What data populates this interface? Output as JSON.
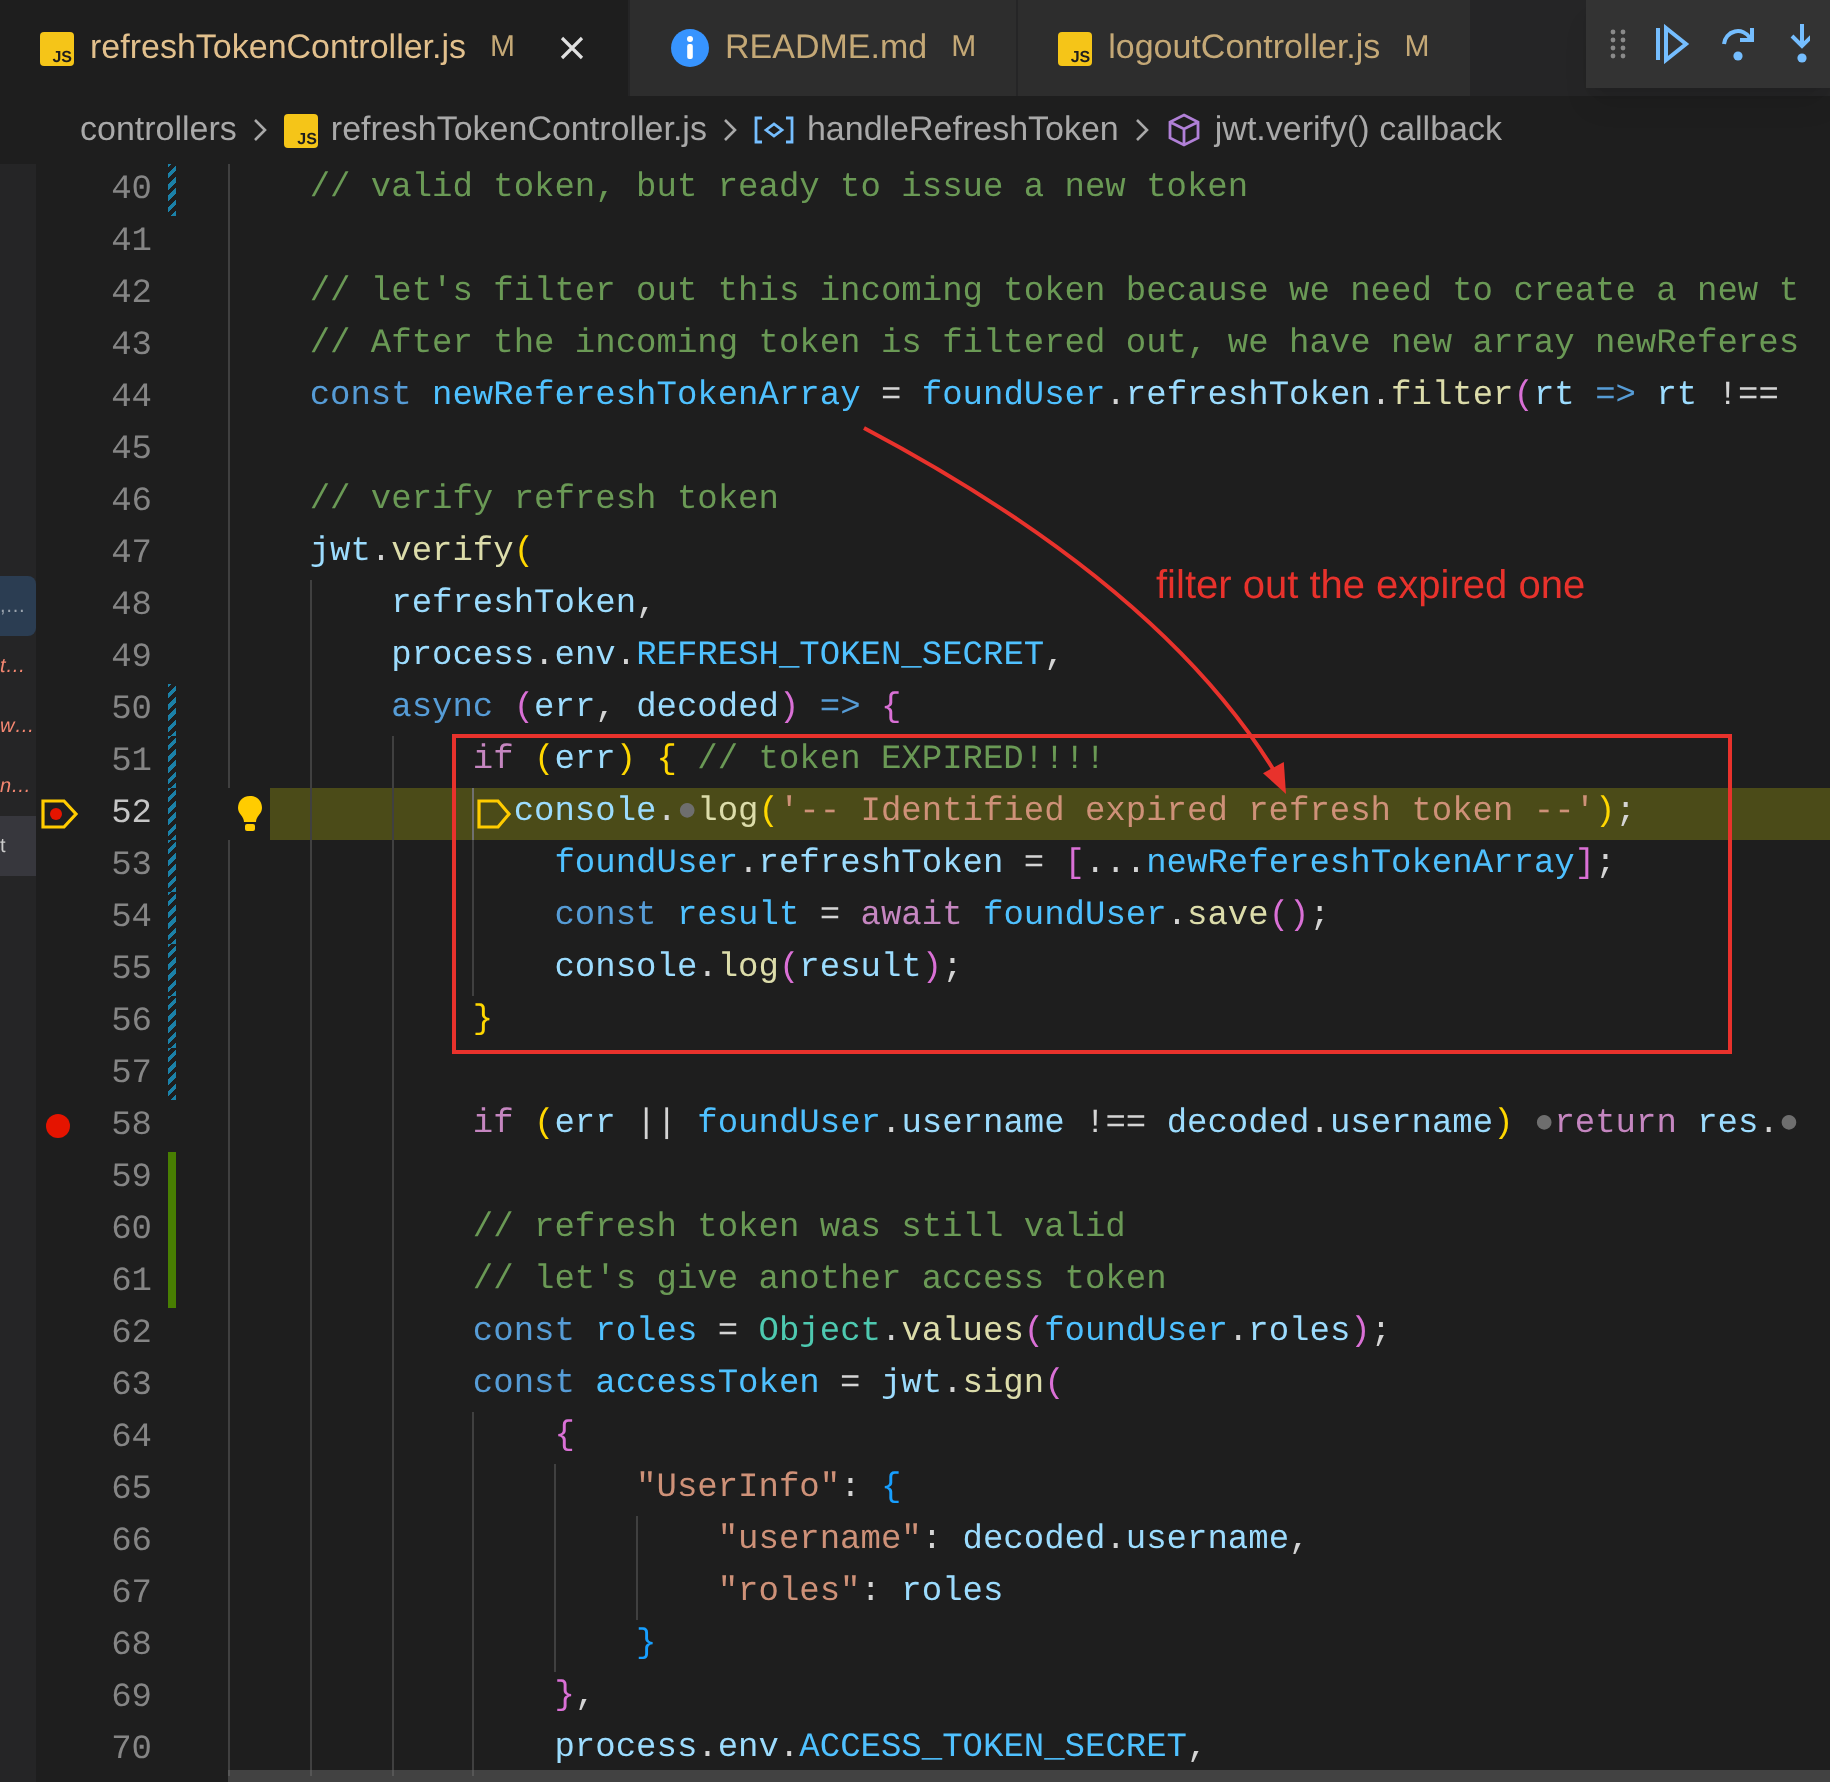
{
  "tabs": [
    {
      "file_icon": "JS",
      "label": "refreshTokenController.js",
      "status": "M",
      "selected": true
    },
    {
      "label": "README.md",
      "status": "M",
      "selected": false
    },
    {
      "file_icon": "JS",
      "label": "logoutController.js",
      "status": "M",
      "selected": false
    }
  ],
  "breadcrumb": [
    {
      "kind": "folder",
      "text": "controllers"
    },
    {
      "kind": "file",
      "file_icon": "JS",
      "text": "refreshTokenController.js"
    },
    {
      "kind": "variable",
      "text": "handleRefreshToken"
    },
    {
      "kind": "method",
      "text": "jwt.verify() callback"
    }
  ],
  "sidebar": {
    "items": [
      {
        "text": ",…",
        "selected": true,
        "error": false,
        "hovered": false
      },
      {
        "text": "t…",
        "selected": false,
        "error": true,
        "hovered": false
      },
      {
        "text": "w…",
        "selected": false,
        "error": true,
        "hovered": false
      },
      {
        "text": "n…",
        "selected": false,
        "error": true,
        "hovered": false
      },
      {
        "text": "t",
        "selected": false,
        "error": false,
        "hovered": true
      }
    ]
  },
  "editor": {
    "lines": [
      {
        "number": "40",
        "modified": true,
        "tokens": [
          {
            "text": "    // valid token, but ready to issue a new token",
            "kind": "comment"
          }
        ]
      },
      {
        "number": "41"
      },
      {
        "number": "42",
        "tokens": [
          {
            "text": "    // let's filter out this incoming token because we need to create a new t",
            "kind": "comment"
          }
        ]
      },
      {
        "number": "43",
        "tokens": [
          {
            "text": "    // After the incoming token is filtered out, we have new array newReferes",
            "kind": "comment"
          }
        ]
      },
      {
        "number": "44",
        "tokens": [
          {
            "text": "    const ",
            "kind": "keyword"
          },
          {
            "text": "newRefereshTokenArray",
            "kind": "constant"
          },
          {
            "text": " = ",
            "kind": "plain"
          },
          {
            "text": "foundUser",
            "kind": "constant"
          },
          {
            "text": ".",
            "kind": "plain"
          },
          {
            "text": "refreshToken",
            "kind": "variable"
          },
          {
            "text": ".",
            "kind": "plain"
          },
          {
            "text": "filter",
            "kind": "function"
          },
          {
            "text": "(",
            "kind": "bracket-pink"
          },
          {
            "text": "rt",
            "kind": "variable"
          },
          {
            "text": " => ",
            "kind": "keyword"
          },
          {
            "text": "rt",
            "kind": "variable"
          },
          {
            "text": " !==",
            "kind": "plain"
          }
        ]
      },
      {
        "number": "45"
      },
      {
        "number": "46",
        "tokens": [
          {
            "text": "    // verify refresh token",
            "kind": "comment"
          }
        ]
      },
      {
        "number": "47",
        "tokens": [
          {
            "text": "    jwt",
            "kind": "variable"
          },
          {
            "text": ".",
            "kind": "plain"
          },
          {
            "text": "verify",
            "kind": "function"
          },
          {
            "text": "(",
            "kind": "bracket-yellow"
          }
        ]
      },
      {
        "number": "48",
        "tokens": [
          {
            "text": "        refreshToken",
            "kind": "variable"
          },
          {
            "text": ",",
            "kind": "plain"
          }
        ]
      },
      {
        "number": "49",
        "tokens": [
          {
            "text": "        process",
            "kind": "variable"
          },
          {
            "text": ".",
            "kind": "plain"
          },
          {
            "text": "env",
            "kind": "variable"
          },
          {
            "text": ".",
            "kind": "plain"
          },
          {
            "text": "REFRESH_TOKEN_SECRET",
            "kind": "constant"
          },
          {
            "text": ",",
            "kind": "plain"
          }
        ]
      },
      {
        "number": "50",
        "modified": true,
        "tokens": [
          {
            "text": "        async ",
            "kind": "keyword"
          },
          {
            "text": "(",
            "kind": "bracket-pink"
          },
          {
            "text": "err",
            "kind": "variable"
          },
          {
            "text": ", ",
            "kind": "plain"
          },
          {
            "text": "decoded",
            "kind": "variable"
          },
          {
            "text": ")",
            "kind": "bracket-pink"
          },
          {
            "text": " => ",
            "kind": "keyword"
          },
          {
            "text": "{",
            "kind": "bracket-pink"
          }
        ]
      },
      {
        "number": "51",
        "modified": true,
        "tokens": [
          {
            "text": "            if ",
            "kind": "control"
          },
          {
            "text": "(",
            "kind": "bracket-yellow"
          },
          {
            "text": "err",
            "kind": "variable"
          },
          {
            "text": ")",
            "kind": "bracket-yellow"
          },
          {
            "text": " {",
            "kind": "bracket-yellow"
          },
          {
            "text": " // token EXPIRED!!!!",
            "kind": "comment"
          }
        ]
      },
      {
        "number": "52",
        "modified": true,
        "current": true,
        "tokens": [
          {
            "text": "              console",
            "kind": "variable"
          },
          {
            "text": ".",
            "kind": "plain"
          },
          {
            "text": "●",
            "kind": "dot"
          },
          {
            "text": "log",
            "kind": "function"
          },
          {
            "text": "(",
            "kind": "bracket-yellow"
          },
          {
            "text": "'-- Identified expired refresh token --'",
            "kind": "string"
          },
          {
            "text": ")",
            "kind": "bracket-yellow"
          },
          {
            "text": ";",
            "kind": "plain"
          }
        ]
      },
      {
        "number": "53",
        "modified": true,
        "tokens": [
          {
            "text": "                foundUser",
            "kind": "constant"
          },
          {
            "text": ".",
            "kind": "plain"
          },
          {
            "text": "refreshToken",
            "kind": "variable"
          },
          {
            "text": " = ",
            "kind": "plain"
          },
          {
            "text": "[",
            "kind": "bracket-pink"
          },
          {
            "text": "...",
            "kind": "plain"
          },
          {
            "text": "newRefereshTokenArray",
            "kind": "constant"
          },
          {
            "text": "]",
            "kind": "bracket-pink"
          },
          {
            "text": ";",
            "kind": "plain"
          }
        ]
      },
      {
        "number": "54",
        "modified": true,
        "tokens": [
          {
            "text": "                const ",
            "kind": "keyword"
          },
          {
            "text": "result",
            "kind": "constant"
          },
          {
            "text": " = ",
            "kind": "plain"
          },
          {
            "text": "await ",
            "kind": "control"
          },
          {
            "text": "foundUser",
            "kind": "constant"
          },
          {
            "text": ".",
            "kind": "plain"
          },
          {
            "text": "save",
            "kind": "function"
          },
          {
            "text": "()",
            "kind": "bracket-pink"
          },
          {
            "text": ";",
            "kind": "plain"
          }
        ]
      },
      {
        "number": "55",
        "modified": true,
        "tokens": [
          {
            "text": "                console",
            "kind": "variable"
          },
          {
            "text": ".",
            "kind": "plain"
          },
          {
            "text": "log",
            "kind": "function"
          },
          {
            "text": "(",
            "kind": "bracket-pink"
          },
          {
            "text": "result",
            "kind": "variable"
          },
          {
            "text": ")",
            "kind": "bracket-pink"
          },
          {
            "text": ";",
            "kind": "plain"
          }
        ]
      },
      {
        "number": "56",
        "modified": true,
        "tokens": [
          {
            "text": "            }",
            "kind": "bracket-yellow"
          }
        ]
      },
      {
        "number": "57",
        "modified": true
      },
      {
        "number": "58",
        "breakpoint": true,
        "tokens": [
          {
            "text": "            if ",
            "kind": "control"
          },
          {
            "text": "(",
            "kind": "bracket-yellow"
          },
          {
            "text": "err",
            "kind": "variable"
          },
          {
            "text": " || ",
            "kind": "plain"
          },
          {
            "text": "foundUser",
            "kind": "constant"
          },
          {
            "text": ".",
            "kind": "plain"
          },
          {
            "text": "username",
            "kind": "variable"
          },
          {
            "text": " !== ",
            "kind": "plain"
          },
          {
            "text": "decoded",
            "kind": "variable"
          },
          {
            "text": ".",
            "kind": "plain"
          },
          {
            "text": "username",
            "kind": "variable"
          },
          {
            "text": ")",
            "kind": "bracket-yellow"
          },
          {
            "text": " ●",
            "kind": "dot"
          },
          {
            "text": "return ",
            "kind": "control"
          },
          {
            "text": "res",
            "kind": "variable"
          },
          {
            "text": ".",
            "kind": "plain"
          },
          {
            "text": "●",
            "kind": "dot"
          }
        ]
      },
      {
        "number": "59",
        "added": true
      },
      {
        "number": "60",
        "added": true,
        "tokens": [
          {
            "text": "            // refresh token was still valid",
            "kind": "comment"
          }
        ]
      },
      {
        "number": "61",
        "added": true,
        "tokens": [
          {
            "text": "            // let's give another access token",
            "kind": "comment"
          }
        ]
      },
      {
        "number": "62",
        "tokens": [
          {
            "text": "            const ",
            "kind": "keyword"
          },
          {
            "text": "roles",
            "kind": "constant"
          },
          {
            "text": " = ",
            "kind": "plain"
          },
          {
            "text": "Object",
            "kind": "class"
          },
          {
            "text": ".",
            "kind": "plain"
          },
          {
            "text": "values",
            "kind": "function"
          },
          {
            "text": "(",
            "kind": "bracket-pink"
          },
          {
            "text": "foundUser",
            "kind": "constant"
          },
          {
            "text": ".",
            "kind": "plain"
          },
          {
            "text": "roles",
            "kind": "variable"
          },
          {
            "text": ")",
            "kind": "bracket-pink"
          },
          {
            "text": ";",
            "kind": "plain"
          }
        ]
      },
      {
        "number": "63",
        "tokens": [
          {
            "text": "            const ",
            "kind": "keyword"
          },
          {
            "text": "accessToken",
            "kind": "constant"
          },
          {
            "text": " = ",
            "kind": "plain"
          },
          {
            "text": "jwt",
            "kind": "variable"
          },
          {
            "text": ".",
            "kind": "plain"
          },
          {
            "text": "sign",
            "kind": "function"
          },
          {
            "text": "(",
            "kind": "bracket-pink"
          }
        ]
      },
      {
        "number": "64",
        "tokens": [
          {
            "text": "                {",
            "kind": "bracket-pink"
          }
        ]
      },
      {
        "number": "65",
        "tokens": [
          {
            "text": "                    \"UserInfo\"",
            "kind": "string"
          },
          {
            "text": ": ",
            "kind": "plain"
          },
          {
            "text": "{",
            "kind": "bracket-blue"
          }
        ]
      },
      {
        "number": "66",
        "tokens": [
          {
            "text": "                        \"username\"",
            "kind": "string"
          },
          {
            "text": ": ",
            "kind": "plain"
          },
          {
            "text": "decoded",
            "kind": "variable"
          },
          {
            "text": ".",
            "kind": "plain"
          },
          {
            "text": "username",
            "kind": "variable"
          },
          {
            "text": ",",
            "kind": "plain"
          }
        ]
      },
      {
        "number": "67",
        "tokens": [
          {
            "text": "                        \"roles\"",
            "kind": "string"
          },
          {
            "text": ": ",
            "kind": "plain"
          },
          {
            "text": "roles",
            "kind": "variable"
          }
        ]
      },
      {
        "number": "68",
        "tokens": [
          {
            "text": "                    }",
            "kind": "bracket-blue"
          }
        ]
      },
      {
        "number": "69",
        "tokens": [
          {
            "text": "                }",
            "kind": "bracket-pink"
          },
          {
            "text": ",",
            "kind": "plain"
          }
        ]
      },
      {
        "number": "70",
        "tokens": [
          {
            "text": "                process",
            "kind": "variable"
          },
          {
            "text": ".",
            "kind": "plain"
          },
          {
            "text": "env",
            "kind": "variable"
          },
          {
            "text": ".",
            "kind": "plain"
          },
          {
            "text": "ACCESS_TOKEN_SECRET",
            "kind": "constant"
          },
          {
            "text": ",",
            "kind": "plain"
          }
        ]
      }
    ]
  },
  "annotation": {
    "text": "filter out the expired one"
  }
}
